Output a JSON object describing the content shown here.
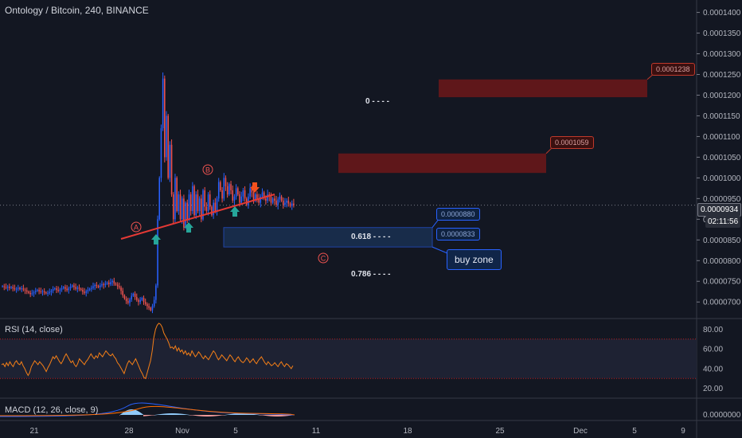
{
  "header": {
    "title": "Ontology / Bitcoin, 240, BINANCE"
  },
  "rsi": {
    "label": "RSI (14, close)",
    "ticks": [
      "80.00",
      "60.00",
      "40.00",
      "20.00"
    ],
    "tick_values": [
      80,
      60,
      40,
      20
    ],
    "upper_band": 70,
    "lower_band": 30,
    "values": [
      44,
      45,
      42,
      46,
      43,
      47,
      44,
      42,
      46,
      48,
      45,
      44,
      47,
      43,
      40,
      36,
      33,
      36,
      42,
      45,
      48,
      46,
      44,
      47,
      45,
      43,
      40,
      37,
      41,
      44,
      48,
      52,
      50,
      53,
      50,
      47,
      45,
      48,
      52,
      55,
      52,
      49,
      46,
      48,
      44,
      42,
      45,
      50,
      48,
      46,
      44,
      47,
      49,
      52,
      55,
      52,
      50,
      53,
      51,
      56,
      54,
      52,
      55,
      58,
      56,
      54,
      53,
      55,
      52,
      50,
      46,
      44,
      41,
      38,
      35,
      40,
      45,
      48,
      46,
      44,
      47,
      50,
      46,
      42,
      38,
      35,
      31,
      30,
      36,
      42,
      48,
      58,
      72,
      80,
      84,
      86,
      85,
      82,
      76,
      73,
      70,
      66,
      61,
      62,
      60,
      63,
      58,
      61,
      57,
      59,
      55,
      58,
      54,
      56,
      53,
      58,
      55,
      52,
      54,
      57,
      55,
      52,
      50,
      53,
      51,
      49,
      52,
      55,
      58,
      56,
      52,
      49,
      51,
      54,
      52,
      50,
      48,
      51,
      54,
      52,
      49,
      47,
      50,
      52,
      49,
      47,
      46,
      48,
      51,
      49,
      46,
      48,
      50,
      47,
      45,
      48,
      50,
      52,
      49,
      46,
      44,
      47,
      45,
      43,
      44,
      46,
      44,
      42,
      45,
      47,
      44,
      42,
      45,
      44,
      42,
      40,
      43
    ]
  },
  "macd": {
    "label": "MACD (12, 26, close, 9)",
    "ticks": [
      "0.0000000"
    ]
  },
  "axis": {
    "price_ticks": [
      "0.0001400",
      "0.0001350",
      "0.0001300",
      "0.0001250",
      "0.0001200",
      "0.0001150",
      "0.0001100",
      "0.0001050",
      "0.0001000",
      "0.0000950",
      "0.0000900",
      "0.0000850",
      "0.0000800",
      "0.0000750",
      "0.0000700"
    ],
    "price_values": [
      0.00014,
      0.000135,
      0.00013,
      0.000125,
      0.00012,
      0.000115,
      0.00011,
      0.000105,
      0.0001,
      9.5e-05,
      9e-05,
      8.5e-05,
      8e-05,
      7.5e-05,
      7e-05
    ],
    "current_price": "0.0000934",
    "current_price_value": 9.34e-05,
    "countdown": "02:11:56",
    "date_ticks": [
      "21",
      "28",
      "Nov",
      "5",
      "11",
      "18",
      "25",
      "Dec",
      "5",
      "9"
    ]
  },
  "annotations": {
    "fib_0": "0",
    "fib_0618": "0.618",
    "fib_0786": "0.786",
    "buy_zone": "buy zone",
    "point_a": "A",
    "point_b": "B",
    "point_c": "C",
    "target_1": "0.0001238",
    "target_2": "0.0001059",
    "buy_top": "0.0000880",
    "buy_bottom": "0.0000833"
  },
  "colors": {
    "background": "#131722",
    "up_candle": "#2962ff",
    "down_candle": "#ef5350",
    "rsi_line": "#f57f17",
    "resistance_zone": "#7a1818",
    "buy_zone": "#1c3a66",
    "green_arrow": "#26a69a",
    "orange_arrow": "#f4511e"
  },
  "chart_data": {
    "type": "candlestick",
    "title": "Ontology / Bitcoin, 240, BINANCE",
    "xlabel": "",
    "ylabel": "",
    "ylim": [
      6.6e-05,
      0.000143
    ],
    "x_tick_labels": [
      "21",
      "28",
      "Nov",
      "5",
      "11",
      "18",
      "25",
      "Dec",
      "5",
      "9"
    ],
    "closes": [
      7.38e-05,
      7.36e-05,
      7.35e-05,
      7.37e-05,
      7.34e-05,
      7.36e-05,
      7.33e-05,
      7.31e-05,
      7.32e-05,
      7.34e-05,
      7.31e-05,
      7.33e-05,
      7.3e-05,
      7.28e-05,
      7.25e-05,
      7.22e-05,
      7.19e-05,
      7.21e-05,
      7.24e-05,
      7.27e-05,
      7.29e-05,
      7.26e-05,
      7.24e-05,
      7.26e-05,
      7.23e-05,
      7.21e-05,
      7.22e-05,
      7.24e-05,
      7.27e-05,
      7.31e-05,
      7.33e-05,
      7.29e-05,
      7.27e-05,
      7.3e-05,
      7.33e-05,
      7.36e-05,
      7.32e-05,
      7.29e-05,
      7.33e-05,
      7.37e-05,
      7.4e-05,
      7.36e-05,
      7.32e-05,
      7.35e-05,
      7.32e-05,
      7.29e-05,
      7.25e-05,
      7.22e-05,
      7.26e-05,
      7.29e-05,
      7.32e-05,
      7.34e-05,
      7.38e-05,
      7.41e-05,
      7.39e-05,
      7.36e-05,
      7.4e-05,
      7.43e-05,
      7.41e-05,
      7.44e-05,
      7.47e-05,
      7.43e-05,
      7.48e-05,
      7.51e-05,
      7.45e-05,
      7.42e-05,
      7.38e-05,
      7.35e-05,
      7.27e-05,
      7.16e-05,
      7.08e-05,
      7.02e-05,
      6.98e-05,
      7.06e-05,
      7.15e-05,
      7.2e-05,
      7.12e-05,
      7.05e-05,
      7e-05,
      7.05e-05,
      7.1e-05,
      7e-05,
      6.95e-05,
      6.9e-05,
      6.86e-05,
      6.8e-05,
      6.9e-05,
      7.05e-05,
      7.4e-05,
      9e-05,
      0.0001,
      0.000112,
      0.000124,
      0.000105,
      0.000115,
      0.0001,
      0.000108,
      9.6e-05,
      9e-05,
      0.0001,
      9.2e-05,
      9.6e-05,
      9e-05,
      9.5e-05,
      8.8e-05,
      9.4e-05,
      9e-05,
      9.6e-05,
      9.2e-05,
      9.8e-05,
      9.1e-05,
      9.6e-05,
      9.2e-05,
      9.5e-05,
      9e-05,
      9.7e-05,
      9.3e-05,
      9.2e-05,
      9.6e-05,
      9.3e-05,
      9.1e-05,
      9.4e-05,
      9.2e-05,
      9.5e-05,
      9.9e-05,
      9.7e-05,
      9.5e-05,
      0.0001,
      9.8e-05,
      9.6e-05,
      9.85e-05,
      9.7e-05,
      9.45e-05,
      9.55e-05,
      9.75e-05,
      9.6e-05,
      9.4e-05,
      9.55e-05,
      9.7e-05,
      9.5e-05,
      9.35e-05,
      9.55e-05,
      9.75e-05,
      9.65e-05,
      9.45e-05,
      9.6e-05,
      9.5e-05,
      9.4e-05,
      9.55e-05,
      9.65e-05,
      9.5e-05,
      9.45e-05,
      9.6e-05,
      9.55e-05,
      9.4e-05,
      9.5e-05,
      9.45e-05,
      9.35e-05,
      9.48e-05,
      9.55e-05,
      9.45e-05,
      9.35e-05,
      9.4e-05,
      9.45e-05,
      9.38e-05,
      9.32e-05,
      9.38e-05,
      9.34e-05
    ]
  }
}
